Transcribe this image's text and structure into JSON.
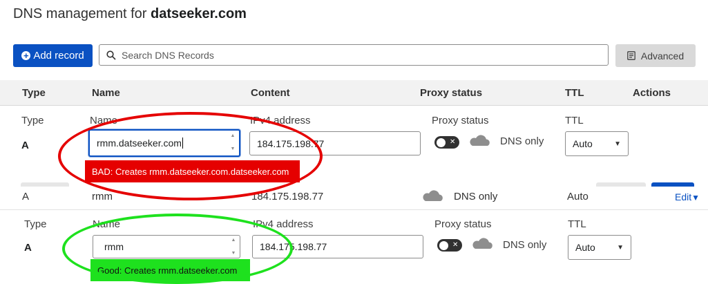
{
  "page": {
    "title_prefix": "DNS management for ",
    "domain": "datseeker.com"
  },
  "toolbar": {
    "add_label": "Add record",
    "search_placeholder": "Search DNS Records",
    "advanced_label": "Advanced"
  },
  "table_header": {
    "type": "Type",
    "name": "Name",
    "content": "Content",
    "proxy": "Proxy status",
    "ttl": "TTL",
    "actions": "Actions"
  },
  "bad_form": {
    "type_label": "Type",
    "type_value": "A",
    "name_label": "Name",
    "name_value": "rmm.datseeker.com",
    "content_label": "IPv4 address",
    "content_value": "184.175.198.77",
    "proxy_label": "Proxy status",
    "proxy_value": "DNS only",
    "ttl_label": "TTL",
    "ttl_value": "Auto",
    "annotation": "BAD: Creates rmm.datseeker.com.datseeker.com"
  },
  "record_row": {
    "type": "A",
    "name": "rmm",
    "content": "184.175.198.77",
    "proxy": "DNS only",
    "ttl": "Auto",
    "edit": "Edit"
  },
  "good_form": {
    "type_label": "Type",
    "type_value": "A",
    "name_label": "Name",
    "name_value": "rmm",
    "content_label": "IPv4 address",
    "content_value": "184.175.198.77",
    "proxy_label": "Proxy status",
    "proxy_value": "DNS only",
    "ttl_label": "TTL",
    "ttl_value": "Auto",
    "annotation": "Good: Creates rmm.datseeker.com"
  },
  "colors": {
    "accent": "#0a51c2",
    "bad": "#e50000",
    "good": "#1ee11e"
  },
  "icons": [
    "plus-icon",
    "search-icon",
    "advanced-icon",
    "cloud-icon",
    "chevron-down-icon",
    "toggle-x-icon"
  ]
}
